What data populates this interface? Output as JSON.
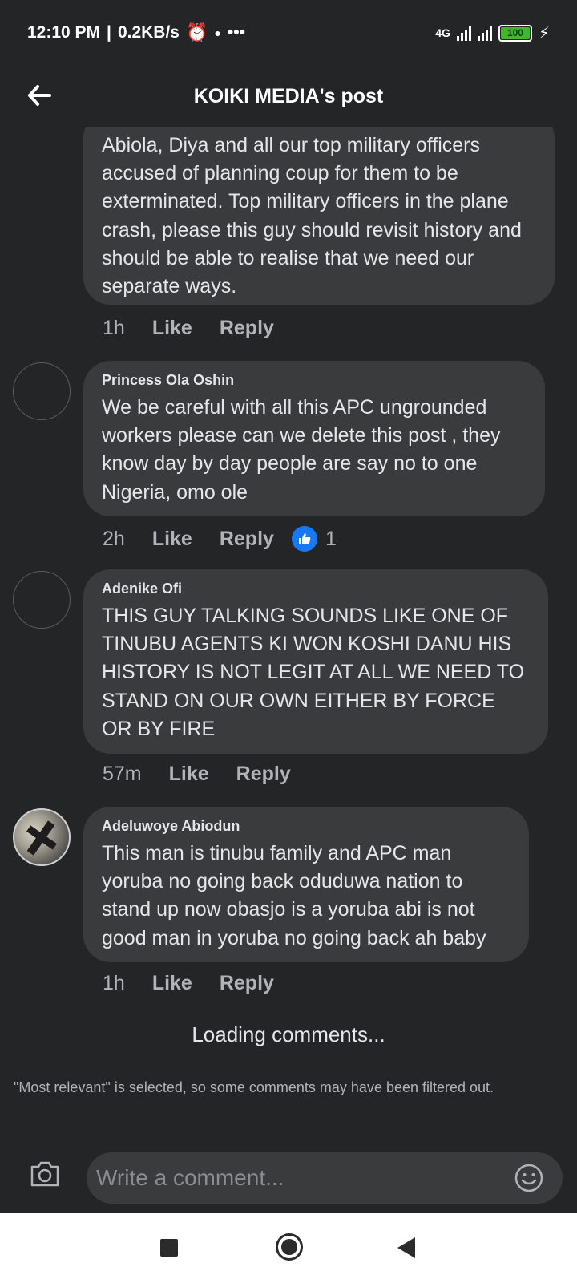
{
  "status_bar": {
    "time": "12:10 PM",
    "speed": "0.2KB/s",
    "network": "4G",
    "battery": "100",
    "dots": "•••",
    "alarm_icon": "alarm-clock-icon",
    "charging_icon": "lightning-bolt-icon"
  },
  "header": {
    "title": "KOIKI MEDIA's post",
    "back_icon": "back-arrow-icon"
  },
  "comments": [
    {
      "author": "",
      "text": "Abiola, Diya and all our top military officers accused of planning coup for them to be exterminated. Top military officers in the plane crash, please this guy should revisit history and should be able to realise that we need our separate ways.",
      "time": "1h",
      "like_label": "Like",
      "reply_label": "Reply"
    },
    {
      "author": "Princess Ola Oshin",
      "text": "We be careful with all this APC ungrounded workers please can we delete this post , they know day by day people are say no to one Nigeria, omo ole",
      "time": "2h",
      "like_label": "Like",
      "reply_label": "Reply",
      "reaction_icon": "thumbs-up-icon",
      "reaction_count": "1"
    },
    {
      "author": "Adenike Ofi",
      "text": "THIS GUY TALKING SOUNDS LIKE ONE OF TINUBU AGENTS KI WON KOSHI DANU HIS HISTORY IS NOT LEGIT AT ALL WE NEED TO STAND ON OUR OWN EITHER BY FORCE OR BY FIRE",
      "time": "57m",
      "like_label": "Like",
      "reply_label": "Reply"
    },
    {
      "author": "Adeluwoye Abiodun",
      "text": "This man is tinubu family and APC man yoruba no going back oduduwa nation to stand up now obasjo is a yoruba abi is not good man in yoruba no going back ah baby",
      "time": "1h",
      "like_label": "Like",
      "reply_label": "Reply"
    }
  ],
  "loading_text": "Loading comments...",
  "filter_note": "\"Most relevant\" is selected, so some comments may have been filtered out.",
  "composer": {
    "placeholder": "Write a comment...",
    "camera_icon": "camera-icon",
    "emoji_icon": "smiley-face-icon"
  },
  "colors": {
    "background": "#242526",
    "bubble": "#3a3b3c",
    "accent": "#1877f2"
  }
}
